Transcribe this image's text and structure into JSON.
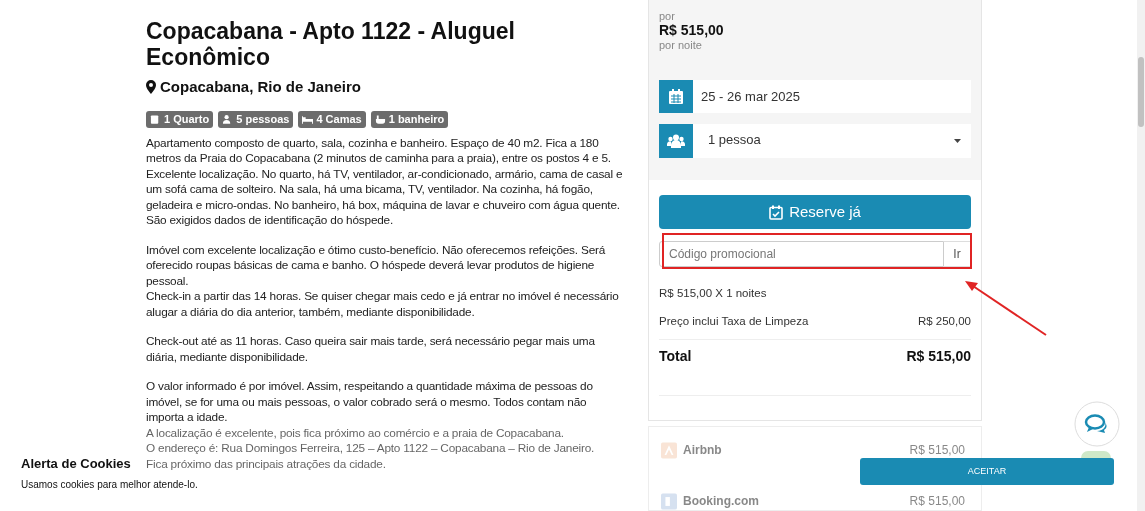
{
  "listing": {
    "title": "Copacabana - Apto 1122 - Aluguel Econômico",
    "location": "Copacabana, Rio de Janeiro",
    "badges": [
      {
        "kind": "room",
        "label": "1 Quarto"
      },
      {
        "kind": "people",
        "label": "5 pessoas"
      },
      {
        "kind": "beds",
        "label": "4 Camas"
      },
      {
        "kind": "bath",
        "label": "1 banheiro"
      }
    ],
    "paragraphs": [
      [
        "Apartamento composto de quarto, sala, cozinha e banheiro. Espaço de 40 m2. Fica a 180 metros da Praia do Copacabana (2 minutos de caminha para a praia), entre os postos 4 e 5. Excelente localização. No quarto, há TV, ventilador, ar-condicionado, armário, cama de casal e um sofá cama de solteiro. Na sala, há uma bicama, TV, ventilador. Na cozinha, há fogão, geladeira e micro-ondas. No banheiro, há box, máquina de lavar e chuveiro com água quente. São exigidos dados de identificação do hóspede."
      ],
      [
        "Imóvel com excelente localização e ótimo custo-benefício. Não oferecemos refeições. Será oferecido roupas básicas de cama e banho. O hóspede deverá levar produtos de higiene pessoal.",
        "Check-in a partir das 14 horas. Se quiser chegar mais cedo e já entrar no imóvel é necessário alugar a diária do dia anterior, também, mediante disponibilidade."
      ],
      [
        "Check-out até as 11 horas. Caso queira sair mais tarde, será necessário pegar mais uma diária, mediante disponibilidade."
      ],
      [
        "O valor informado é por imóvel. Assim, respeitando a quantidade máxima de pessoas do imóvel, se for uma ou mais pessoas, o valor cobrado será o mesmo. Todos contam não importa a idade.",
        "A localização é excelente, pois fica próximo ao comércio e a praia de Copacabana.",
        "O endereço é: Rua Domingos Ferreira, 125 – Apto 1122 – Copacabana – Rio de Janeiro.",
        "Fica próximo das principais atrações da cidade."
      ]
    ]
  },
  "booking": {
    "price_prefix": "por",
    "price": "R$ 515,00",
    "price_suffix": "por noite",
    "dates": "25 - 26 mar 2025",
    "guests": "1 pessoa",
    "reserve_button": "Reserve já",
    "promo": {
      "placeholder": "Código promocional",
      "button": "Ir"
    },
    "lines": [
      {
        "label": "R$ 515,00 X 1 noites"
      },
      {
        "label": "Preço inclui Taxa de Limpeza",
        "value": "R$ 250,00"
      }
    ],
    "total": {
      "label": "Total",
      "value": "R$ 515,00"
    }
  },
  "comparison": [
    {
      "kind": "airbnb",
      "name": "Airbnb",
      "price": "R$ 515,00"
    },
    {
      "kind": "booking",
      "name": "Booking.com",
      "price": "R$ 515,00"
    }
  ],
  "cookie_banner": {
    "title": "Alerta de Cookies",
    "message": "Usamos cookies para melhor atende-lo.",
    "button": "ACEITAR"
  }
}
